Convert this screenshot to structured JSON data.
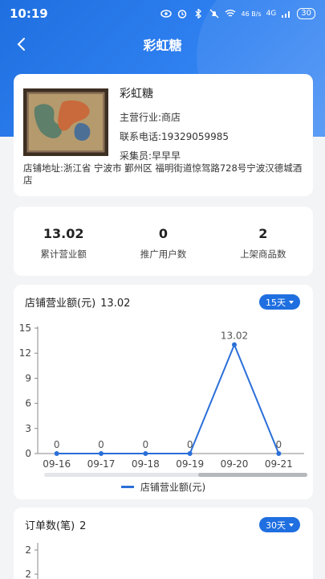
{
  "status": {
    "time": "10:19",
    "network": "4G",
    "speed": "46 B/s",
    "battery": "30"
  },
  "nav": {
    "title": "彩虹糖"
  },
  "store": {
    "name": "彩虹糖",
    "industry": "主营行业:商店",
    "phone": "联系电话:19329059985",
    "collector": "采集员:早早早",
    "address": "店铺地址:浙江省 宁波市 鄞州区 福明街道惊驾路728号宁波汉德城酒店"
  },
  "stats": [
    {
      "value": "13.02",
      "label": "累计营业额"
    },
    {
      "value": "0",
      "label": "推广用户数"
    },
    {
      "value": "2",
      "label": "上架商品数"
    }
  ],
  "revenue_chart": {
    "title": "店铺营业额(元)",
    "total": "13.02",
    "range_label": "15天",
    "legend": "店铺营业额(元)",
    "colors": {
      "line": "#2a6fd8"
    },
    "chart_data": {
      "type": "line",
      "x": [
        "09-16",
        "09-17",
        "09-18",
        "09-19",
        "09-20",
        "09-21"
      ],
      "series": [
        {
          "name": "店铺营业额(元)",
          "values": [
            0,
            0,
            0,
            0,
            13.02,
            0
          ]
        }
      ],
      "yticks": [
        "0",
        "3",
        "6",
        "9",
        "12",
        "15"
      ],
      "ylim": [
        0,
        15
      ],
      "data_labels": [
        "0",
        "0",
        "0",
        "0",
        "13.02",
        "0"
      ]
    }
  },
  "order_chart": {
    "title": "订单数(笔)",
    "total": "2",
    "range_label": "30天",
    "yticks": [
      "2",
      "2"
    ]
  }
}
